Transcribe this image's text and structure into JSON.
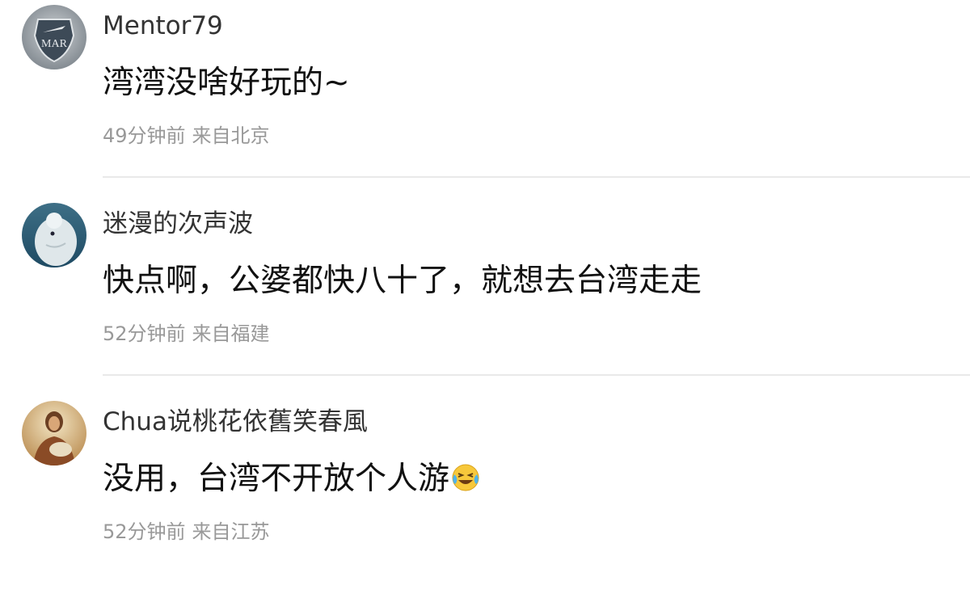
{
  "comments": [
    {
      "username": "Mentor79",
      "text": "湾湾没啥好玩的~",
      "time": "49分钟前",
      "location": "来自北京",
      "avatar_icon": "shield-logo-avatar"
    },
    {
      "username": "迷漫的次声波",
      "text": "快点啊，公婆都快八十了，就想去台湾走走",
      "time": "52分钟前",
      "location": "来自福建",
      "avatar_icon": "beluga-avatar"
    },
    {
      "username": "Chua说桃花依舊笑春風",
      "text": "没用，台湾不开放个人游",
      "time": "52分钟前",
      "location": "来自江苏",
      "avatar_icon": "painting-portrait-avatar",
      "emoji": "laugh-cry-emoji"
    }
  ],
  "colors": {
    "username": "#333333",
    "content": "#111111",
    "meta": "#999999",
    "divider": "#e9e9e9"
  }
}
